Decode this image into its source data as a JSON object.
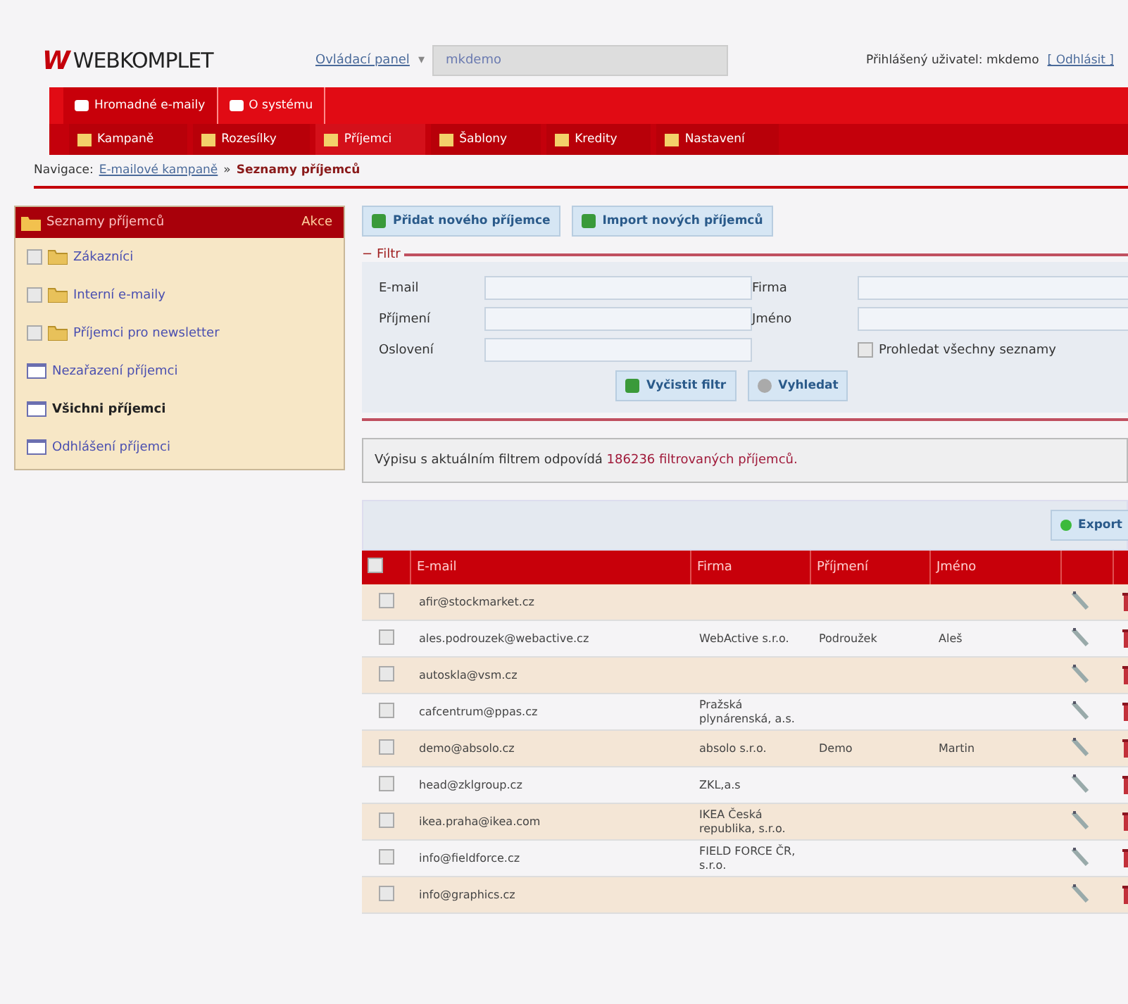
{
  "logo": {
    "mark": "W",
    "text": "WEBKOMPLET"
  },
  "top": {
    "panel_link": "Ovládací panel",
    "separator": "▾",
    "account_value": "mkdemo",
    "user_label": "Přihlášený uživatel:",
    "user_name": "mkdemo",
    "logout": "[ Odhlásit ]"
  },
  "main_tabs": [
    {
      "label": "Hromadné e-maily",
      "selected": true
    },
    {
      "label": "O systému",
      "selected": false
    }
  ],
  "sub_tabs": [
    {
      "label": "Kampaně",
      "selected": false
    },
    {
      "label": "Rozesílky",
      "selected": false
    },
    {
      "label": "Příjemci",
      "selected": true
    },
    {
      "label": "Šablony",
      "selected": false
    },
    {
      "label": "Kredity",
      "selected": false
    },
    {
      "label": "Nastavení",
      "selected": false
    }
  ],
  "breadcrumb": {
    "label": "Navigace:",
    "link": "E-mailové kampaně",
    "separator": "»",
    "current": "Seznamy příjemců"
  },
  "sidebar": {
    "title": "Seznamy příjemců",
    "action": "Akce",
    "items": [
      {
        "kind": "folder",
        "label": "Zákazníci",
        "checked": false,
        "selected": false
      },
      {
        "kind": "folder",
        "label": "Interní e-maily",
        "checked": false,
        "selected": false
      },
      {
        "kind": "folder",
        "label": "Příjemci pro newsletter",
        "checked": false,
        "selected": false
      },
      {
        "kind": "list",
        "label": "Nezařazení příjemci",
        "selected": false
      },
      {
        "kind": "list",
        "label": "Všichni příjemci",
        "selected": true
      },
      {
        "kind": "list",
        "label": "Odhlášení příjemci",
        "selected": false
      }
    ]
  },
  "actions": [
    "Přidat nového příjemce",
    "Import nových příjemců"
  ],
  "filter": {
    "legend": "Filtr",
    "toggle": "−",
    "fields": [
      {
        "label": "E-mail"
      },
      {
        "label": "Firma"
      },
      {
        "label": "Příjmení"
      },
      {
        "label": "Jméno"
      },
      {
        "label": "Oslovení"
      }
    ],
    "search_all": {
      "label": "Prohledat všechny seznamy",
      "checked": false
    },
    "clear": "Vyčistit filtr",
    "search": "Vyhledat"
  },
  "result": {
    "prefix": "Výpisu s aktuálním filtrem odpovídá",
    "count": "186236 filtrovaných příjemců."
  },
  "export": "Export",
  "table": {
    "select_all_checked": false,
    "columns": [
      "E-mail",
      "Firma",
      "Příjmení",
      "Jméno"
    ],
    "rows": [
      {
        "email": "afir@stockmarket.cz",
        "firma": "",
        "prijmeni": "",
        "jmeno": "",
        "checked": false
      },
      {
        "email": "ales.podrouzek@webactive.cz",
        "firma": "WebActive s.r.o.",
        "prijmeni": "Podroužek",
        "jmeno": "Aleš",
        "checked": false
      },
      {
        "email": "autoskla@vsm.cz",
        "firma": "",
        "prijmeni": "",
        "jmeno": "",
        "checked": false
      },
      {
        "email": "cafcentrum@ppas.cz",
        "firma": "Pražská plynárenská, a.s.",
        "prijmeni": "",
        "jmeno": "",
        "checked": false
      },
      {
        "email": "demo@absolo.cz",
        "firma": "absolo s.r.o.",
        "prijmeni": "Demo",
        "jmeno": "Martin",
        "checked": false
      },
      {
        "email": "head@zklgroup.cz",
        "firma": "ZKL,a.s",
        "prijmeni": "",
        "jmeno": "",
        "checked": false
      },
      {
        "email": "ikea.praha@ikea.com",
        "firma": "IKEA Česká republika, s.r.o.",
        "prijmeni": "",
        "jmeno": "",
        "checked": false
      },
      {
        "email": "info@fieldforce.cz",
        "firma": "FIELD FORCE ČR, s.r.o.",
        "prijmeni": "",
        "jmeno": "",
        "checked": false
      },
      {
        "email": "info@graphics.cz",
        "firma": "",
        "prijmeni": "",
        "jmeno": "",
        "checked": false
      }
    ]
  }
}
